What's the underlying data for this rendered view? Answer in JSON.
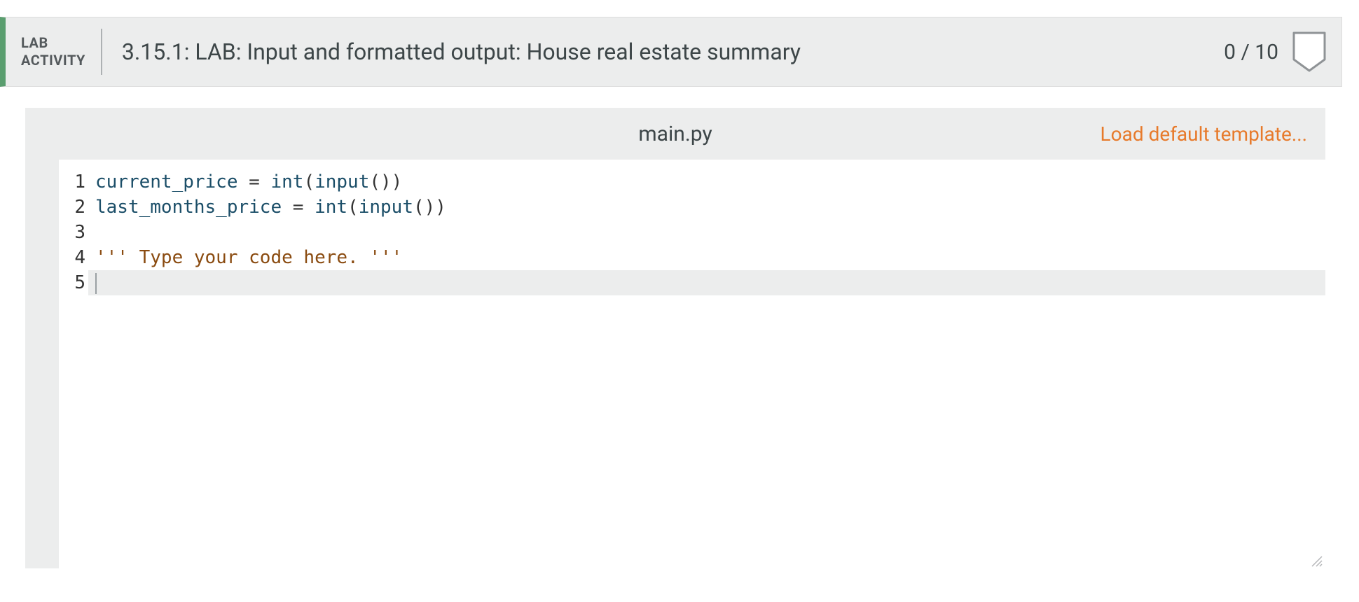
{
  "header": {
    "badge_line1": "LAB",
    "badge_line2": "ACTIVITY",
    "title": "3.15.1: LAB: Input and formatted output: House real estate summary",
    "score": "0 / 10"
  },
  "file": {
    "name": "main.py",
    "load_template_label": "Load default template..."
  },
  "code": {
    "lines": [
      {
        "n": "1",
        "segments": [
          {
            "t": "current_price",
            "c": "tok-var"
          },
          {
            "t": " = ",
            "c": "tok-op"
          },
          {
            "t": "int",
            "c": "tok-builtin"
          },
          {
            "t": "(",
            "c": "tok-paren"
          },
          {
            "t": "input",
            "c": "tok-builtin"
          },
          {
            "t": "())",
            "c": "tok-paren"
          }
        ]
      },
      {
        "n": "2",
        "segments": [
          {
            "t": "last_months_price",
            "c": "tok-var"
          },
          {
            "t": " = ",
            "c": "tok-op"
          },
          {
            "t": "int",
            "c": "tok-builtin"
          },
          {
            "t": "(",
            "c": "tok-paren"
          },
          {
            "t": "input",
            "c": "tok-builtin"
          },
          {
            "t": "())",
            "c": "tok-paren"
          }
        ]
      },
      {
        "n": "3",
        "segments": []
      },
      {
        "n": "4",
        "segments": [
          {
            "t": "''' Type your code here. '''",
            "c": "tok-string"
          }
        ]
      },
      {
        "n": "5",
        "segments": [],
        "active": true
      }
    ]
  }
}
